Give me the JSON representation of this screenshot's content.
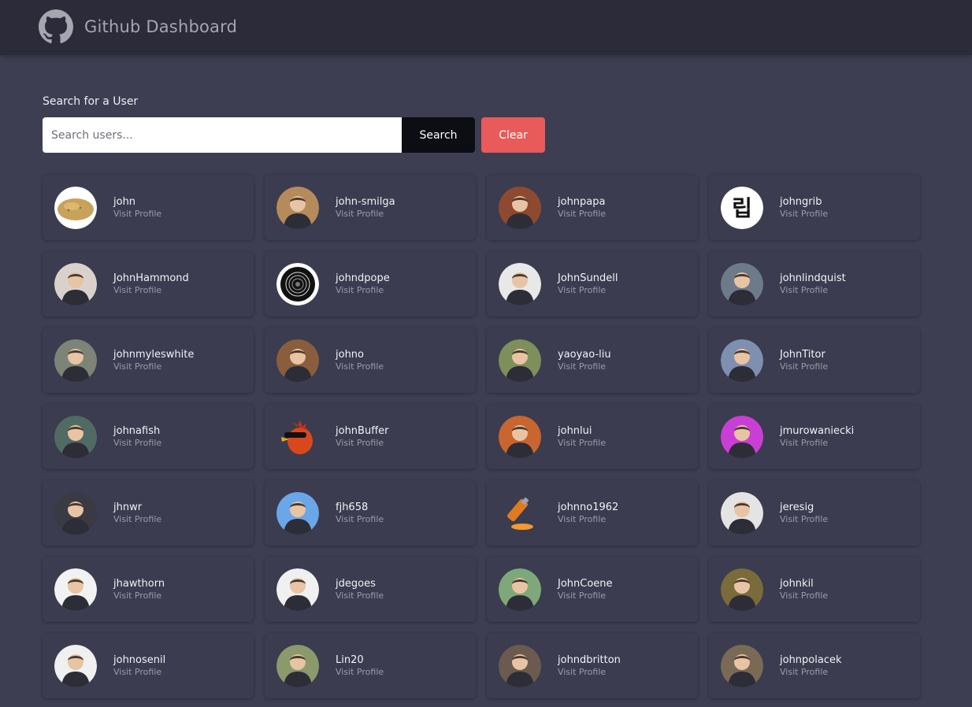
{
  "header": {
    "title": "Github Dashboard"
  },
  "search": {
    "label": "Search for a User",
    "placeholder": "Search users...",
    "value": "",
    "search_label": "Search",
    "clear_label": "Clear"
  },
  "colors": {
    "accent_clear": "#e95a5a",
    "search_button": "#0d0d14",
    "background": "#3d3e52",
    "navbar": "#2b2b3a"
  },
  "users": [
    {
      "login": "john",
      "link": "Visit Profile",
      "avatar": "potato",
      "tone": "#e6e6e6"
    },
    {
      "login": "john-smilga",
      "link": "Visit Profile",
      "avatar": "person",
      "tone": "#b58b5c"
    },
    {
      "login": "johnpapa",
      "link": "Visit Profile",
      "avatar": "person",
      "tone": "#8e4a2f"
    },
    {
      "login": "johngrib",
      "link": "Visit Profile",
      "avatar": "hangul",
      "tone": "#ffffff"
    },
    {
      "login": "JohnHammond",
      "link": "Visit Profile",
      "avatar": "person",
      "tone": "#d9d2cc"
    },
    {
      "login": "johndpope",
      "link": "Visit Profile",
      "avatar": "target",
      "tone": "#ffffff"
    },
    {
      "login": "JohnSundell",
      "link": "Visit Profile",
      "avatar": "person",
      "tone": "#e8e8e8"
    },
    {
      "login": "johnlindquist",
      "link": "Visit Profile",
      "avatar": "person",
      "tone": "#6d7a8a"
    },
    {
      "login": "johnmyleswhite",
      "link": "Visit Profile",
      "avatar": "person",
      "tone": "#7c8478"
    },
    {
      "login": "johno",
      "link": "Visit Profile",
      "avatar": "person",
      "tone": "#8a5d3c"
    },
    {
      "login": "yaoyao-liu",
      "link": "Visit Profile",
      "avatar": "person",
      "tone": "#7d8f5a"
    },
    {
      "login": "JohnTitor",
      "link": "Visit Profile",
      "avatar": "person",
      "tone": "#7f8fb0"
    },
    {
      "login": "johnafish",
      "link": "Visit Profile",
      "avatar": "person",
      "tone": "#4f6b63"
    },
    {
      "login": "johnBuffer",
      "link": "Visit Profile",
      "avatar": "bird",
      "tone": "#3b3c4f"
    },
    {
      "login": "johnlui",
      "link": "Visit Profile",
      "avatar": "person",
      "tone": "#c9652e"
    },
    {
      "login": "jmurowaniecki",
      "link": "Visit Profile",
      "avatar": "person",
      "tone": "#c93fd6"
    },
    {
      "login": "jhnwr",
      "link": "Visit Profile",
      "avatar": "person",
      "tone": "#3a3a44"
    },
    {
      "login": "fjh658",
      "link": "Visit Profile",
      "avatar": "person",
      "tone": "#6aa7e8"
    },
    {
      "login": "johnno1962",
      "link": "Visit Profile",
      "avatar": "syringe",
      "tone": "#3b3c4f"
    },
    {
      "login": "jeresig",
      "link": "Visit Profile",
      "avatar": "person",
      "tone": "#e4e4e4"
    },
    {
      "login": "jhawthorn",
      "link": "Visit Profile",
      "avatar": "person",
      "tone": "#f2f2f2"
    },
    {
      "login": "jdegoes",
      "link": "Visit Profile",
      "avatar": "person",
      "tone": "#f0f0f0"
    },
    {
      "login": "JohnCoene",
      "link": "Visit Profile",
      "avatar": "person",
      "tone": "#7fa87a"
    },
    {
      "login": "johnkil",
      "link": "Visit Profile",
      "avatar": "person",
      "tone": "#7a6b3a"
    },
    {
      "login": "johnosenil",
      "link": "Visit Profile",
      "avatar": "person",
      "tone": "#f0f0f0"
    },
    {
      "login": "Lin20",
      "link": "Visit Profile",
      "avatar": "person",
      "tone": "#8a9a6b"
    },
    {
      "login": "johndbritton",
      "link": "Visit Profile",
      "avatar": "person",
      "tone": "#6b5a4f"
    },
    {
      "login": "johnpolacek",
      "link": "Visit Profile",
      "avatar": "person",
      "tone": "#7a6a55"
    }
  ]
}
